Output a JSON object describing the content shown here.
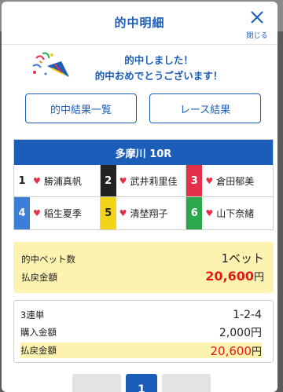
{
  "header": {
    "title": "的中明細",
    "close_label": "閉じる"
  },
  "congrats": {
    "line1": "的中しました！",
    "line2": "的中おめでとうございます！"
  },
  "buttons": {
    "hit_results": "的中結果一覧",
    "race_results": "レース結果"
  },
  "race": {
    "name": "多摩川 10R",
    "entries": [
      {
        "num": "1",
        "name": "勝浦真帆",
        "bg": "#ffffff",
        "fg": "#222222"
      },
      {
        "num": "2",
        "name": "武井莉里佳",
        "bg": "#222222",
        "fg": "#ffffff"
      },
      {
        "num": "3",
        "name": "倉田郁美",
        "bg": "#e5304a",
        "fg": "#ffffff"
      },
      {
        "num": "4",
        "name": "稲生夏季",
        "bg": "#3d7fd6",
        "fg": "#ffffff"
      },
      {
        "num": "5",
        "name": "清埜翔子",
        "bg": "#f2d51b",
        "fg": "#222222"
      },
      {
        "num": "6",
        "name": "山下奈緒",
        "bg": "#2aa84a",
        "fg": "#ffffff"
      }
    ]
  },
  "summary": {
    "bet_count_label": "的中ベット数",
    "bet_count_value": "1ベット",
    "payout_label": "払戻金額",
    "payout_amount": "20,600",
    "payout_unit": "円"
  },
  "detail": {
    "bet_type": "3連単",
    "combination": "1-2-4",
    "purchase_label": "購入金額",
    "purchase_value": "2,000円",
    "payout_label": "払戻金額",
    "payout_amount": "20,600",
    "payout_unit": "円"
  },
  "pager": {
    "current": "1"
  },
  "colors": {
    "accent": "#1b5db8",
    "highlight": "#fdf2b0",
    "payout": "#e21a1a"
  }
}
